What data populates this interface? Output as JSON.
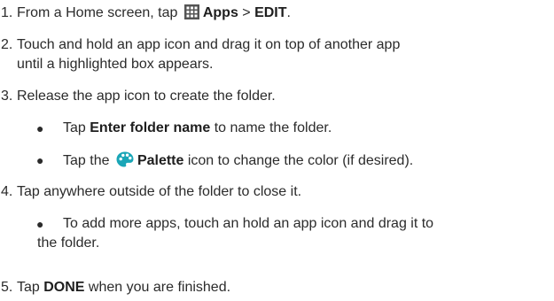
{
  "steps": [
    {
      "num": "1.",
      "before": "From a Home screen, tap ",
      "bold1": "Apps",
      "sep": " > ",
      "bold2": "EDIT",
      "after": "."
    },
    {
      "num": "2.",
      "line1": "Touch and hold an app icon and drag it on top of another app",
      "line2": "until a highlighted box appears."
    },
    {
      "num": "3.",
      "text": "Release the app icon to create the folder."
    },
    {
      "num": "4.",
      "text": "Tap anywhere outside of the folder to close it."
    },
    {
      "num": "5.",
      "before": "Tap ",
      "bold": "DONE",
      "after": " when you are finished."
    }
  ],
  "bullets": [
    {
      "before": "Tap ",
      "bold": "Enter folder name",
      "after": " to name the folder."
    },
    {
      "before": "Tap the ",
      "bold": "Palette",
      "after": " icon to change the color (if desired)."
    },
    {
      "line1": "To add more apps, touch an hold an app icon and drag it to",
      "line2": "the folder."
    }
  ],
  "bullet_glyph": "●",
  "icons": {
    "apps": "apps-grid-icon",
    "palette": "palette-icon",
    "palette_color": "#1aa6b7"
  }
}
